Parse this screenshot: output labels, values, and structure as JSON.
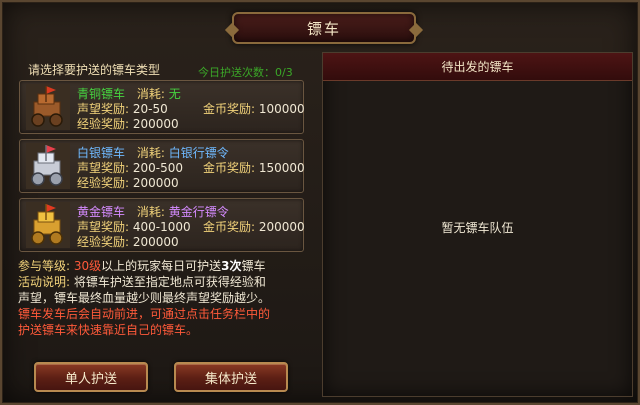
{
  "title": "镖车",
  "left": {
    "prompt": "请选择要护送的镖车类型",
    "daily_count": "今日护送次数：0/3"
  },
  "carts": [
    {
      "name": "青铜镖车",
      "cost_label": "消耗:",
      "cost_value": "无",
      "prestige_label": "声望奖励:",
      "prestige_value": "20-50",
      "gold_label": "金币奖励:",
      "gold_value": "100000",
      "exp_label": "经验奖励:",
      "exp_value": "200000",
      "icon": "bronze-cart-icon"
    },
    {
      "name": "白银镖车",
      "cost_label": "消耗:",
      "cost_value": "白银行镖令",
      "prestige_label": "声望奖励:",
      "prestige_value": "200-500",
      "gold_label": "金币奖励:",
      "gold_value": "150000",
      "exp_label": "经验奖励:",
      "exp_value": "200000",
      "icon": "silver-cart-icon"
    },
    {
      "name": "黄金镖车",
      "cost_label": "消耗:",
      "cost_value": "黄金行镖令",
      "prestige_label": "声望奖励:",
      "prestige_value": "400-1000",
      "gold_label": "金币奖励:",
      "gold_value": "200000",
      "exp_label": "经验奖励:",
      "exp_value": "200000",
      "icon": "gold-cart-icon"
    }
  ],
  "info": {
    "level_label": "参与等级:",
    "level_value": "30级",
    "level_rest_1": "以上的玩家每日可护送",
    "level_times": "3次",
    "level_rest_2": "镖车",
    "desc_label": "活动说明:",
    "desc_text_1": "将镖车护送至指定地点可获得经验和",
    "desc_text_2": "声望，镖车最终血量越少则最终声望奖励越少。",
    "warn_1": "镖车发车后会自动前进，可通过点击任务栏中的",
    "warn_2": "护送镖车来快速靠近自己的镖车。"
  },
  "buttons": {
    "solo": "单人护送",
    "team": "集体护送"
  },
  "right": {
    "header": "待出发的镖车",
    "empty": "暂无镖车队伍"
  },
  "colors": {
    "accent_red": "#4e1414",
    "name_bronze": "#46d340",
    "name_silver": "#6fb9ff",
    "name_gold": "#d58bff",
    "label_yellow": "#f1d27a",
    "warning_red": "#ff5a3a"
  }
}
